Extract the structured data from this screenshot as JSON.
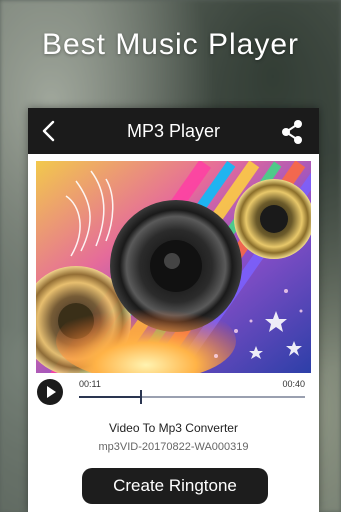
{
  "promo": {
    "title": "Best Music Player"
  },
  "appbar": {
    "title": "MP3 Player",
    "back_icon": "chevron-left-icon",
    "share_icon": "share-icon"
  },
  "artwork": {
    "description_icon": "speaker-artwork"
  },
  "player": {
    "current_time": "00:11",
    "duration": "00:40",
    "progress": 0.275,
    "play_icon": "play-icon"
  },
  "track": {
    "title": "Video To Mp3 Converter",
    "filename": "mp3VID-20170822-WA000319"
  },
  "actions": {
    "create_ringtone": "Create Ringtone"
  },
  "colors": {
    "appbar": "#1b1b1b",
    "button": "#1d1d1d",
    "progress": "#2a3550"
  }
}
